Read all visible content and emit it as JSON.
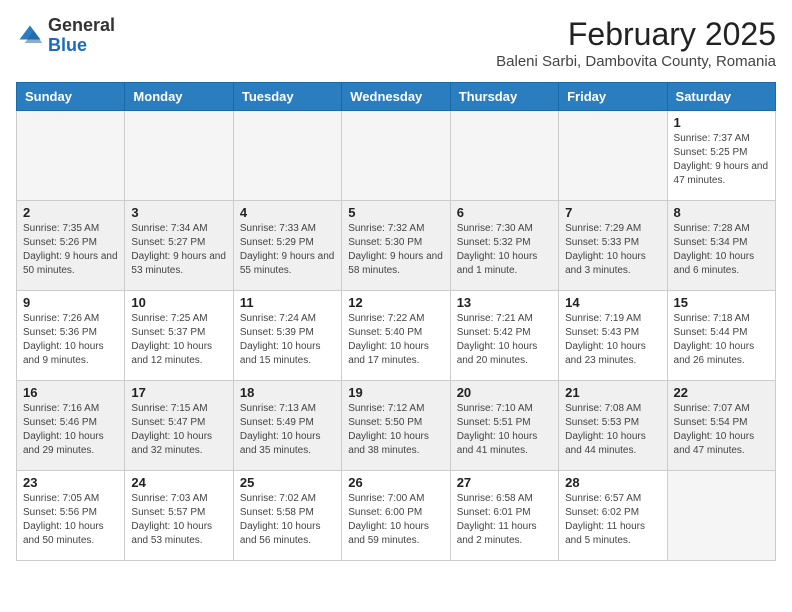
{
  "header": {
    "logo_line1": "General",
    "logo_line2": "Blue",
    "month_year": "February 2025",
    "location": "Baleni Sarbi, Dambovita County, Romania"
  },
  "days_of_week": [
    "Sunday",
    "Monday",
    "Tuesday",
    "Wednesday",
    "Thursday",
    "Friday",
    "Saturday"
  ],
  "weeks": [
    {
      "shaded": false,
      "days": [
        {
          "num": "",
          "info": ""
        },
        {
          "num": "",
          "info": ""
        },
        {
          "num": "",
          "info": ""
        },
        {
          "num": "",
          "info": ""
        },
        {
          "num": "",
          "info": ""
        },
        {
          "num": "",
          "info": ""
        },
        {
          "num": "1",
          "info": "Sunrise: 7:37 AM\nSunset: 5:25 PM\nDaylight: 9 hours and 47 minutes."
        }
      ]
    },
    {
      "shaded": true,
      "days": [
        {
          "num": "2",
          "info": "Sunrise: 7:35 AM\nSunset: 5:26 PM\nDaylight: 9 hours and 50 minutes."
        },
        {
          "num": "3",
          "info": "Sunrise: 7:34 AM\nSunset: 5:27 PM\nDaylight: 9 hours and 53 minutes."
        },
        {
          "num": "4",
          "info": "Sunrise: 7:33 AM\nSunset: 5:29 PM\nDaylight: 9 hours and 55 minutes."
        },
        {
          "num": "5",
          "info": "Sunrise: 7:32 AM\nSunset: 5:30 PM\nDaylight: 9 hours and 58 minutes."
        },
        {
          "num": "6",
          "info": "Sunrise: 7:30 AM\nSunset: 5:32 PM\nDaylight: 10 hours and 1 minute."
        },
        {
          "num": "7",
          "info": "Sunrise: 7:29 AM\nSunset: 5:33 PM\nDaylight: 10 hours and 3 minutes."
        },
        {
          "num": "8",
          "info": "Sunrise: 7:28 AM\nSunset: 5:34 PM\nDaylight: 10 hours and 6 minutes."
        }
      ]
    },
    {
      "shaded": false,
      "days": [
        {
          "num": "9",
          "info": "Sunrise: 7:26 AM\nSunset: 5:36 PM\nDaylight: 10 hours and 9 minutes."
        },
        {
          "num": "10",
          "info": "Sunrise: 7:25 AM\nSunset: 5:37 PM\nDaylight: 10 hours and 12 minutes."
        },
        {
          "num": "11",
          "info": "Sunrise: 7:24 AM\nSunset: 5:39 PM\nDaylight: 10 hours and 15 minutes."
        },
        {
          "num": "12",
          "info": "Sunrise: 7:22 AM\nSunset: 5:40 PM\nDaylight: 10 hours and 17 minutes."
        },
        {
          "num": "13",
          "info": "Sunrise: 7:21 AM\nSunset: 5:42 PM\nDaylight: 10 hours and 20 minutes."
        },
        {
          "num": "14",
          "info": "Sunrise: 7:19 AM\nSunset: 5:43 PM\nDaylight: 10 hours and 23 minutes."
        },
        {
          "num": "15",
          "info": "Sunrise: 7:18 AM\nSunset: 5:44 PM\nDaylight: 10 hours and 26 minutes."
        }
      ]
    },
    {
      "shaded": true,
      "days": [
        {
          "num": "16",
          "info": "Sunrise: 7:16 AM\nSunset: 5:46 PM\nDaylight: 10 hours and 29 minutes."
        },
        {
          "num": "17",
          "info": "Sunrise: 7:15 AM\nSunset: 5:47 PM\nDaylight: 10 hours and 32 minutes."
        },
        {
          "num": "18",
          "info": "Sunrise: 7:13 AM\nSunset: 5:49 PM\nDaylight: 10 hours and 35 minutes."
        },
        {
          "num": "19",
          "info": "Sunrise: 7:12 AM\nSunset: 5:50 PM\nDaylight: 10 hours and 38 minutes."
        },
        {
          "num": "20",
          "info": "Sunrise: 7:10 AM\nSunset: 5:51 PM\nDaylight: 10 hours and 41 minutes."
        },
        {
          "num": "21",
          "info": "Sunrise: 7:08 AM\nSunset: 5:53 PM\nDaylight: 10 hours and 44 minutes."
        },
        {
          "num": "22",
          "info": "Sunrise: 7:07 AM\nSunset: 5:54 PM\nDaylight: 10 hours and 47 minutes."
        }
      ]
    },
    {
      "shaded": false,
      "days": [
        {
          "num": "23",
          "info": "Sunrise: 7:05 AM\nSunset: 5:56 PM\nDaylight: 10 hours and 50 minutes."
        },
        {
          "num": "24",
          "info": "Sunrise: 7:03 AM\nSunset: 5:57 PM\nDaylight: 10 hours and 53 minutes."
        },
        {
          "num": "25",
          "info": "Sunrise: 7:02 AM\nSunset: 5:58 PM\nDaylight: 10 hours and 56 minutes."
        },
        {
          "num": "26",
          "info": "Sunrise: 7:00 AM\nSunset: 6:00 PM\nDaylight: 10 hours and 59 minutes."
        },
        {
          "num": "27",
          "info": "Sunrise: 6:58 AM\nSunset: 6:01 PM\nDaylight: 11 hours and 2 minutes."
        },
        {
          "num": "28",
          "info": "Sunrise: 6:57 AM\nSunset: 6:02 PM\nDaylight: 11 hours and 5 minutes."
        },
        {
          "num": "",
          "info": ""
        }
      ]
    }
  ]
}
